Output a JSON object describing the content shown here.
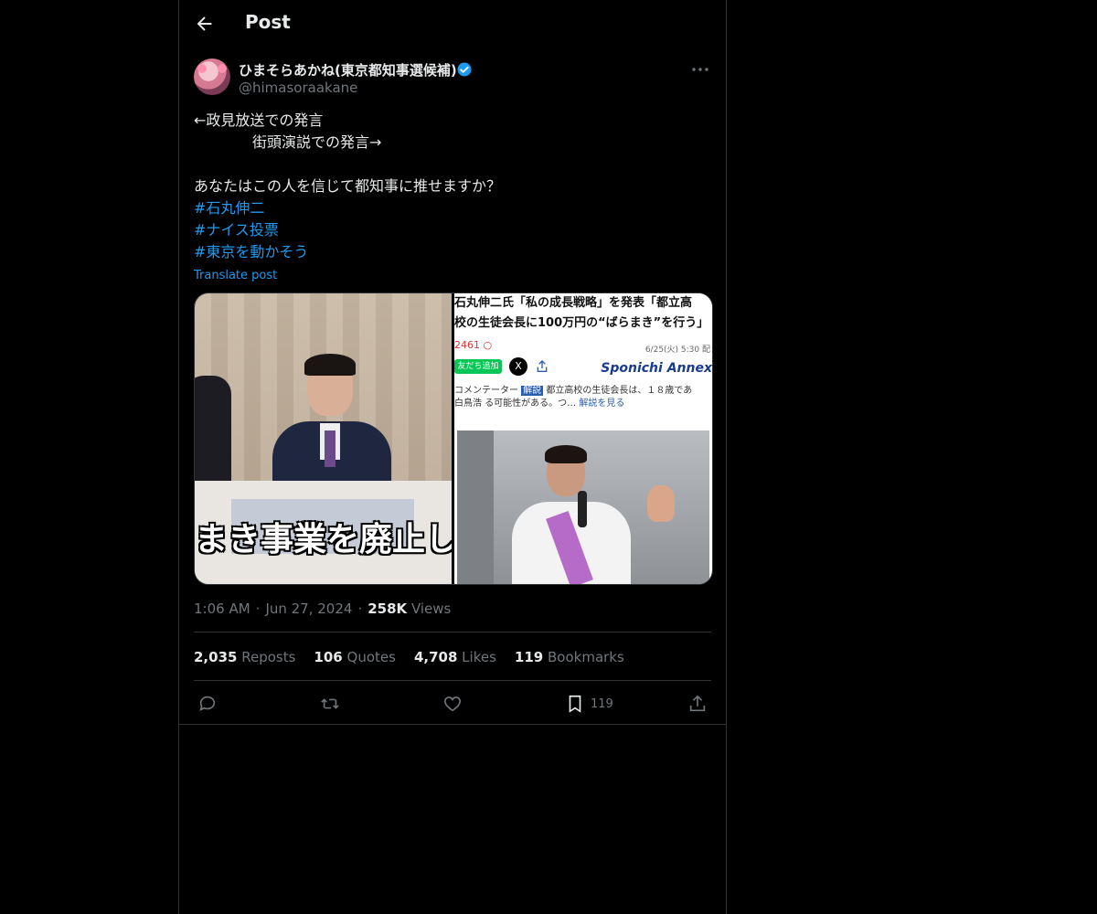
{
  "header": {
    "title": "Post"
  },
  "author": {
    "display_name": "ひまそらあかね(東京都知事選候補)",
    "handle": "@himasoraakane",
    "verified_color": "#1d9bf0"
  },
  "post": {
    "lines": [
      "←政見放送での発言",
      "　　　　街頭演説での発言→",
      "",
      "あなたはこの人を信じて都知事に推せますか？"
    ],
    "hashtags": [
      "#石丸伸二",
      "#ナイス投票",
      "#東京を動かそう"
    ],
    "translate_label": "Translate post"
  },
  "media": {
    "left_caption": "まき事業を廃止し",
    "article_title_1": "石丸伸二氏「私の成長戦略」を発表「都立高",
    "article_title_2": "校の生徒会長に100万円の“ばらまき”を行う」",
    "article_count": "2461",
    "article_date": "6/25(火) 5:30 配",
    "friend_label": "友だち追加",
    "x_label": "X",
    "sponichi_label": "Sponichi Annex",
    "commenter_label": "コメンテーター",
    "commenter_name": "白鳥浩",
    "comment_tag": "解説",
    "comment_text": "都立高校の生徒会長は、１８歳であ",
    "comment_text_2": "る可能性がある。つ…",
    "comment_link": "解説を見る"
  },
  "meta": {
    "time": "1:06 AM",
    "date": "Jun 27, 2024",
    "views_count": "258K",
    "views_label": "Views"
  },
  "stats": {
    "reposts_count": "2,035",
    "reposts_label": "Reposts",
    "quotes_count": "106",
    "quotes_label": "Quotes",
    "likes_count": "4,708",
    "likes_label": "Likes",
    "bookmarks_count": "119",
    "bookmarks_label": "Bookmarks"
  },
  "actions": {
    "bookmark_count": "119"
  },
  "colors": {
    "background": "#000000",
    "text": "#e7e9ea",
    "muted": "#71767b",
    "link": "#1d9bf0",
    "border": "#2f3336"
  }
}
